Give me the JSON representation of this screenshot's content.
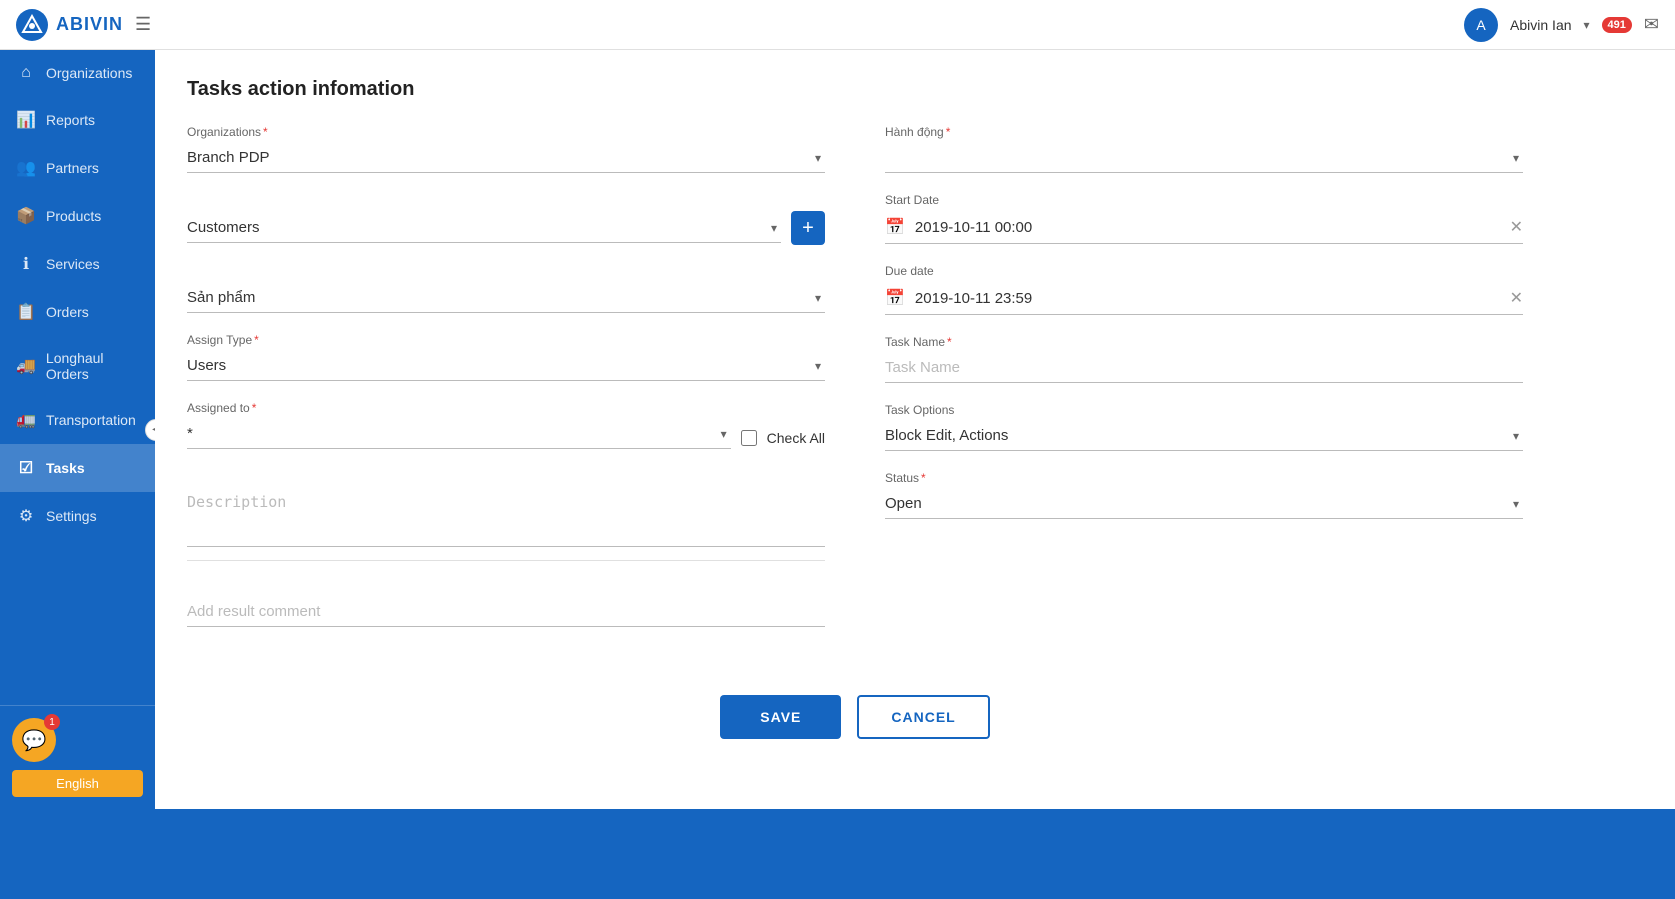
{
  "app": {
    "logo_text": "ABIVIN",
    "logo_abbr": "A"
  },
  "topbar": {
    "hamburger_label": "☰",
    "user_name": "Abivin Ian",
    "user_abbr": "A",
    "notif_count": "491"
  },
  "sidebar": {
    "items": [
      {
        "id": "organizations",
        "label": "Organizations",
        "icon": "⌂",
        "active": false
      },
      {
        "id": "reports",
        "label": "Reports",
        "icon": "📊",
        "active": false
      },
      {
        "id": "partners",
        "label": "Partners",
        "icon": "👥",
        "active": false
      },
      {
        "id": "products",
        "label": "Products",
        "icon": "📦",
        "active": false
      },
      {
        "id": "services",
        "label": "Services",
        "icon": "ℹ",
        "active": false
      },
      {
        "id": "orders",
        "label": "Orders",
        "icon": "📋",
        "active": false
      },
      {
        "id": "longhaul-orders",
        "label": "Longhaul Orders",
        "icon": "🚚",
        "active": false
      },
      {
        "id": "transportation",
        "label": "Transportation",
        "icon": "🚛",
        "active": false
      },
      {
        "id": "tasks",
        "label": "Tasks",
        "icon": "☑",
        "active": true
      },
      {
        "id": "settings",
        "label": "Settings",
        "icon": "⚙",
        "active": false
      }
    ],
    "chat_badge": "1",
    "language": "English"
  },
  "form": {
    "title": "Tasks action infomation",
    "fields": {
      "organizations_label": "Organizations",
      "organizations_value": "Branch PDP",
      "customers_label": "Customers",
      "customers_value": "Customers",
      "san_pham_label": "Sản phẩm",
      "san_pham_value": "Sản phẩm",
      "assign_type_label": "Assign Type",
      "assign_type_value": "Users",
      "assigned_to_label": "Assigned to",
      "assigned_to_value": "",
      "assigned_to_placeholder": "*",
      "check_all_label": "Check All",
      "description_label": "Description",
      "description_placeholder": "Description",
      "add_result_label": "Add result comment",
      "hanh_dong_label": "Hành động",
      "hanh_dong_value": "",
      "start_date_label": "Start Date",
      "start_date_value": "2019-10-11 00:00",
      "due_date_label": "Due date",
      "due_date_value": "2019-10-11 23:59",
      "task_name_label": "Task Name",
      "task_name_placeholder": "Task Name",
      "task_options_label": "Task Options",
      "task_options_value": "Block Edit, Actions",
      "status_label": "Status",
      "status_value": "Open",
      "save_btn": "SAVE",
      "cancel_btn": "CANCEL"
    }
  }
}
